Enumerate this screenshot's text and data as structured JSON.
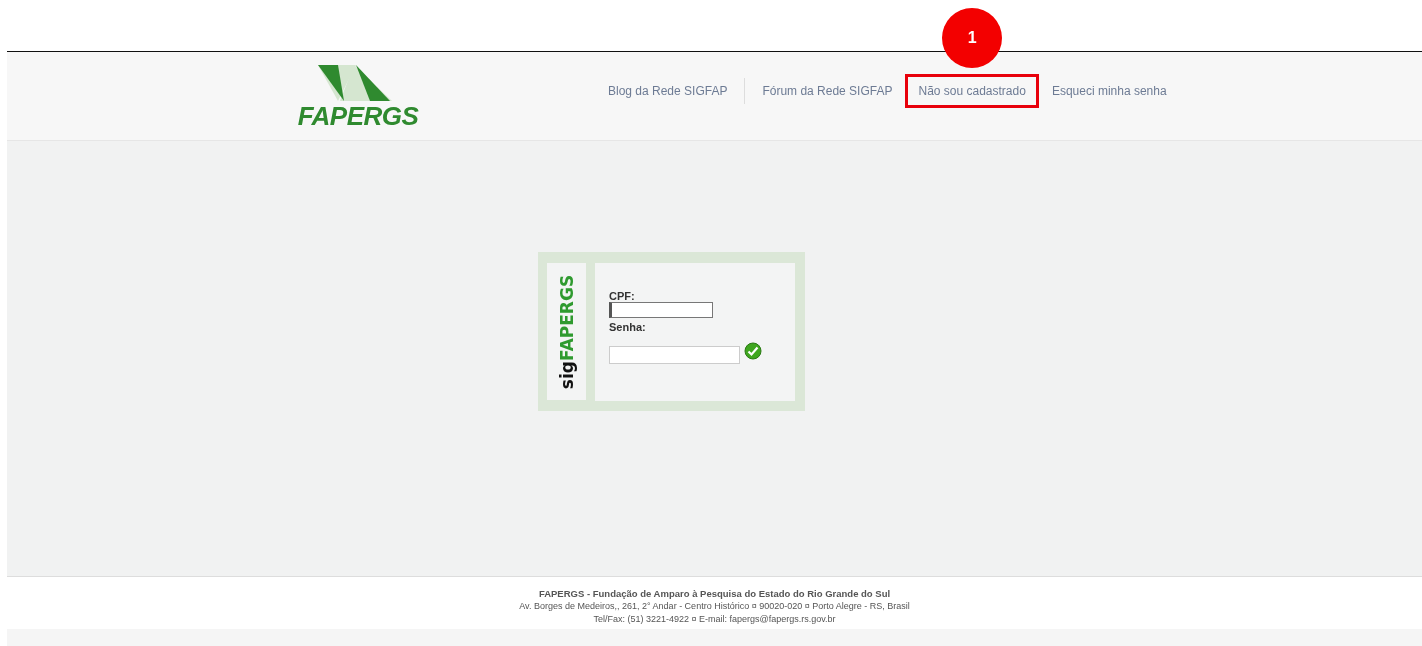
{
  "header": {
    "logo_text": "FAPERGS",
    "nav": [
      {
        "label": "Blog da Rede SIGFAP",
        "highlighted": false
      },
      {
        "label": "Fórum da Rede SIGFAP",
        "highlighted": false
      },
      {
        "label": "Não sou cadastrado",
        "highlighted": true
      },
      {
        "label": "Esqueci minha senha",
        "highlighted": false
      }
    ]
  },
  "annotation": {
    "label": "1"
  },
  "login": {
    "side_logo_prefix": "sig",
    "side_logo_name": "FAPERGS",
    "fields": [
      {
        "label": "CPF:",
        "focused": true
      },
      {
        "label": "Senha:",
        "focused": false
      }
    ]
  },
  "footer": {
    "lines": [
      "FAPERGS - Fundação de Amparo à Pesquisa do Estado do Rio Grande do Sul",
      "Av. Borges de Medeiros,, 261, 2° Andar - Centro Histórico ¤ 90020-020 ¤ Porto Alegre - RS, Brasil",
      "Tel/Fax: (51) 3221-4922 ¤ E-mail: fapergs@fapergs.rs.gov.br"
    ]
  }
}
